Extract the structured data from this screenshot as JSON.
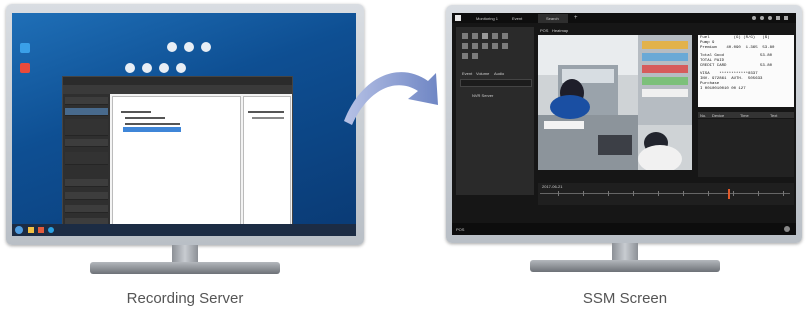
{
  "captions": {
    "left": "Recording Server",
    "right": "SSM Screen"
  },
  "ssm_screen": {
    "tabs": [
      "Monitoring 1",
      "Event",
      "Search"
    ],
    "sub_tabs": [
      "POS",
      "Heatmap"
    ],
    "panel_tabs": [
      "Event",
      "Volume",
      "Audio"
    ],
    "tree_item": "NVR Server",
    "receipt_lines": [
      "Fuel          (G) (R/G)   ($)",
      "Pump 9",
      "Premium    40.090  1.365  53.80",
      "Total Good               53.80",
      "TOTAL PAID",
      "CREDIT CARD              53.80",
      "VISA    ************0337",
      "INV. 972861  AUTH.  505633",
      "Purchase",
      "I 0010010010 00 127"
    ],
    "list_headers": [
      "No.",
      "Device",
      "Time",
      "Text"
    ],
    "timeline_date": "2017-06-21",
    "status_left": "POS"
  },
  "colors": {
    "arrow": "#7a8fc8",
    "desktop_blue": "#1562ad",
    "ssm_dark": "#161616"
  }
}
